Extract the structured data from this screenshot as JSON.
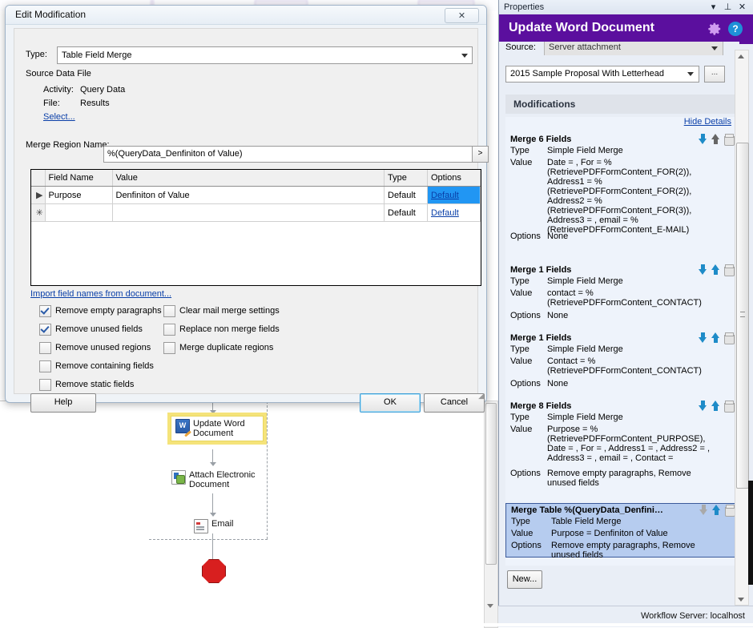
{
  "dialog": {
    "title": "Edit Modification",
    "close_label": "✕",
    "type_label": "Type:",
    "type_value": "Table Field Merge",
    "source_group": "Source Data File",
    "activity_label": "Activity:",
    "activity_value": "Query Data",
    "file_label": "File:",
    "file_value": "Results",
    "select_link": "Select...",
    "merge_region_label": "Merge Region Name:",
    "merge_region_value": "%(QueryData_Denfiniton of Value)",
    "merge_region_btn": ">",
    "import_link": "Import field names from document...",
    "grid": {
      "columns": [
        "Field Name",
        "Value",
        "Type",
        "Options"
      ],
      "rows": [
        {
          "indicator": "▶",
          "field_name": "Purpose",
          "value": "Denfiniton of Value",
          "type": "Default",
          "options": "Default",
          "selected": true
        },
        {
          "indicator": "✳",
          "field_name": "",
          "value": "",
          "type": "Default",
          "options": "Default",
          "selected": false
        }
      ]
    },
    "checkboxes_left": [
      {
        "label": "Remove empty paragraphs",
        "checked": true
      },
      {
        "label": "Remove unused fields",
        "checked": true
      },
      {
        "label": "Remove unused regions",
        "checked": false
      },
      {
        "label": "Remove containing fields",
        "checked": false
      },
      {
        "label": "Remove static fields",
        "checked": false
      }
    ],
    "checkboxes_right": [
      {
        "label": "Clear mail merge settings",
        "checked": false
      },
      {
        "label": "Replace non merge fields",
        "checked": false
      },
      {
        "label": "Merge duplicate regions",
        "checked": false
      }
    ],
    "help_button": "Help",
    "ok_button": "OK",
    "cancel_button": "Cancel"
  },
  "properties": {
    "panel_title": "Properties",
    "header_title": "Update Word Document",
    "source_label": "Source:",
    "source_value": "Server attachment",
    "document_value": "2015 Sample Proposal With Letterhead",
    "browse_label": "...",
    "modifications_header": "Modifications",
    "hide_details_link": "Hide Details",
    "new_button": "New...",
    "row_keys": {
      "type": "Type",
      "value": "Value",
      "options": "Options"
    },
    "modifications": [
      {
        "title": "Merge 6 Fields",
        "type": "Simple Field Merge",
        "value": "Date = , For = %(RetrievePDFFormContent_FOR(2)), Address1 = %(RetrievePDFFormContent_FOR(2)), Address2 = %(RetrievePDFFormContent_FOR(3)), Address3 = , email = %(RetrievePDFFormContent_E-MAIL)",
        "options": "None",
        "selected": false,
        "down_enabled": true
      },
      {
        "title": "Merge 1 Fields",
        "type": "Simple Field Merge",
        "value": "contact = %(RetrievePDFFormContent_CONTACT)",
        "options": "None",
        "selected": false,
        "down_enabled": true
      },
      {
        "title": "Merge 1 Fields",
        "type": "Simple Field Merge",
        "value": "Contact = %(RetrievePDFFormContent_CONTACT)",
        "options": "None",
        "selected": false,
        "down_enabled": true
      },
      {
        "title": "Merge 8 Fields",
        "type": "Simple Field Merge",
        "value": "Purpose = %(RetrievePDFFormContent_PURPOSE), Date = , For = , Address1 = , Address2 = , Address3 = , email = , Contact =",
        "options": "Remove empty paragraphs, Remove unused fields",
        "selected": false,
        "down_enabled": true
      },
      {
        "title": "Merge Table %(QueryData_Denfini…",
        "type": "Table Field Merge",
        "value": "Purpose = Denfiniton of Value",
        "options": "Remove empty paragraphs, Remove unused fields",
        "selected": true,
        "down_enabled": false
      }
    ]
  },
  "workflow": {
    "nodes": [
      {
        "label": "Update Word Document",
        "icon": "word-icon",
        "selected": true
      },
      {
        "label": "Attach Electronic Document",
        "icon": "attach-icon",
        "selected": false
      },
      {
        "label": "Email",
        "icon": "email-icon",
        "selected": false
      }
    ],
    "stop_node": "stop-node"
  },
  "statusbar": {
    "text": "Workflow Server: localhost"
  },
  "colors": {
    "header_purple": "#5b0f9e",
    "selection_blue": "#2196f3",
    "mod_selected": "#b6ccef",
    "link": "#0a3fa8",
    "stop_red": "#d81f1f",
    "selected_node_outline": "#f5e37a"
  }
}
